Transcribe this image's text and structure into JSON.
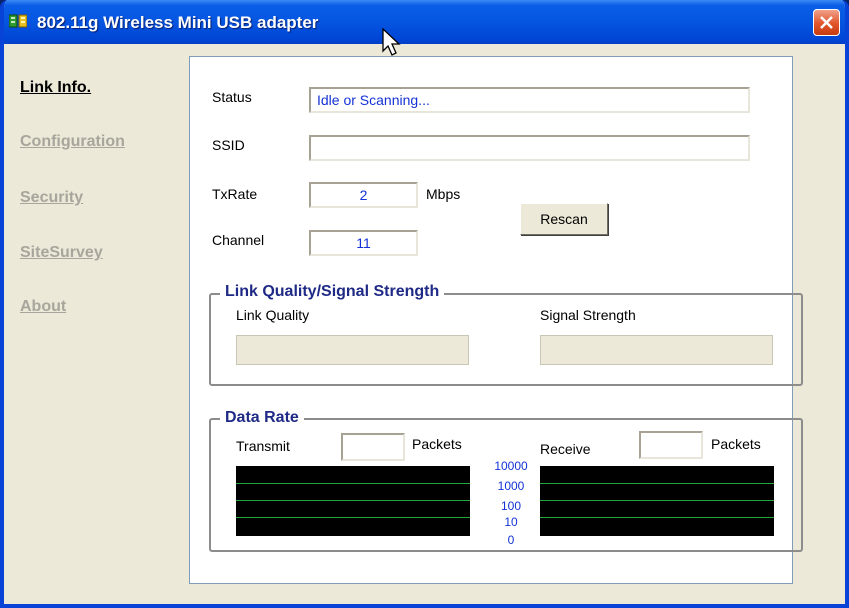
{
  "window": {
    "title": "802.11g Wireless Mini USB adapter"
  },
  "sidebar": {
    "items": [
      {
        "label": "Link Info.",
        "active": true
      },
      {
        "label": "Configuration",
        "active": false
      },
      {
        "label": "Security",
        "active": false
      },
      {
        "label": "SiteSurvey",
        "active": false
      },
      {
        "label": "About",
        "active": false
      }
    ]
  },
  "link_info": {
    "status_label": "Status",
    "status_value": "Idle or Scanning...",
    "ssid_label": "SSID",
    "ssid_value": "",
    "txrate_label": "TxRate",
    "txrate_value": "2",
    "txrate_unit": "Mbps",
    "channel_label": "Channel",
    "channel_value": "11",
    "rescan_label": "Rescan"
  },
  "link_quality": {
    "group_title": "Link Quality/Signal Strength",
    "quality_label": "Link Quality",
    "signal_label": "Signal Strength"
  },
  "data_rate": {
    "group_title": "Data Rate",
    "transmit_label": "Transmit",
    "receive_label": "Receive",
    "packets_label": "Packets",
    "transmit_packets": "",
    "receive_packets": "",
    "scale": [
      "10000",
      "1000",
      "100",
      "10",
      "0"
    ]
  },
  "colors": {
    "title_bar": "#0555e0",
    "value_text": "#1432d6",
    "group_title": "#1f2a86",
    "graph_bg": "#000000",
    "graph_grid": "#23a63a"
  }
}
